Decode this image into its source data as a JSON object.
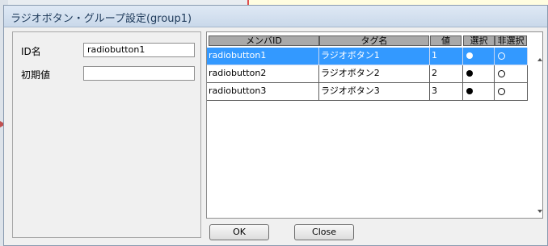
{
  "dialog": {
    "title": "ラジオボタン・グループ設定(group1)"
  },
  "form": {
    "id_label": "ID名",
    "id_value": "radiobutton1",
    "initial_label": "初期値",
    "initial_value": ""
  },
  "table": {
    "columns": [
      "メンバID",
      "タグ名",
      "値",
      "選択",
      "非選択"
    ],
    "rows": [
      {
        "member_id": "radiobutton1",
        "tag_name": "ラジオボタン1",
        "value": "1",
        "selected": true
      },
      {
        "member_id": "radiobutton2",
        "tag_name": "ラジオボタン2",
        "value": "2",
        "selected": false
      },
      {
        "member_id": "radiobutton3",
        "tag_name": "ラジオボタン3",
        "value": "3",
        "selected": false
      }
    ],
    "selected_row": 0
  },
  "buttons": {
    "ok": "OK",
    "close": "Close"
  },
  "icons": {
    "select_marker": "filled-circle",
    "unselect_marker": "empty-circle"
  },
  "colors": {
    "selection": "#3399ff",
    "header": "#a9a9a9"
  }
}
